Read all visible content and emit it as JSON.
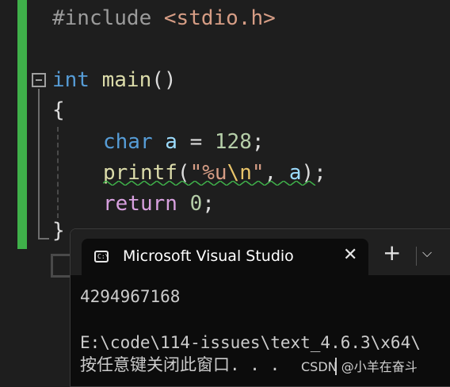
{
  "editor": {
    "lines": [
      {
        "pp": "#include",
        "inc": " <stdio.h>"
      },
      {
        "kw": "int",
        "fn": " main",
        "rest": "()"
      },
      {
        "text": "{"
      },
      {
        "kw": "char",
        "var": " a",
        "op": " = ",
        "num": "128",
        "end": ";"
      },
      {
        "fn": "printf",
        "p1": "(",
        "str1": "\"%u",
        "esc": "\\n",
        "str2": "\"",
        "p2": ", ",
        "var": "a",
        "end": ");"
      },
      {
        "kw": "return",
        "num": " 0",
        "end": ";"
      },
      {
        "text": "}"
      }
    ]
  },
  "terminal": {
    "tab_icon": "C:\\",
    "tab_title": "Microsoft Visual Studio",
    "close_label": "✕",
    "new_tab_label": "+",
    "dropdown_label": "⌵",
    "output_lines": [
      "4294967168",
      "",
      "E:\\code\\114-issues\\text_4.6.3\\x64\\",
      "按任意键关闭此窗口. . ."
    ]
  },
  "watermark": "CSDN @小羊在奋斗",
  "colors": {
    "change_bar": "#3fb04a",
    "keyword": "#569cd6",
    "function": "#dcdcaa",
    "number": "#b5cea8",
    "variable": "#9cdcfe",
    "string": "#d69d85"
  }
}
